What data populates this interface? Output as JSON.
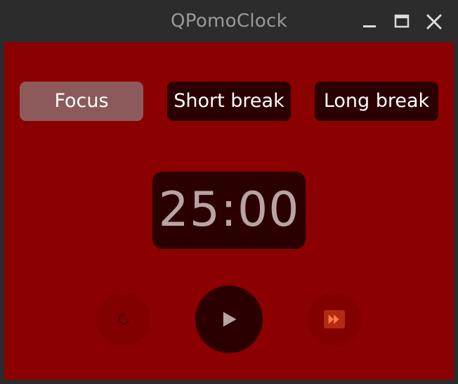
{
  "window": {
    "title": "QPomoClock",
    "controls": [
      "minimize-icon",
      "maximize-icon",
      "close-icon"
    ]
  },
  "modes": {
    "focus_label": "Focus",
    "short_label": "Short break",
    "long_label": "Long break",
    "active": "Focus"
  },
  "timer": {
    "display": "25:00"
  },
  "controls": {
    "reset_icon": "reset-icon",
    "play_icon": "play-icon",
    "skip_icon": "skip-forward-icon"
  },
  "colors": {
    "background": "#8b0000",
    "panel_dark": "#2b0000",
    "active_mode": "#8c5a5b",
    "timer_text": "#b9a3a4",
    "titlebar": "#2c2c2c"
  }
}
